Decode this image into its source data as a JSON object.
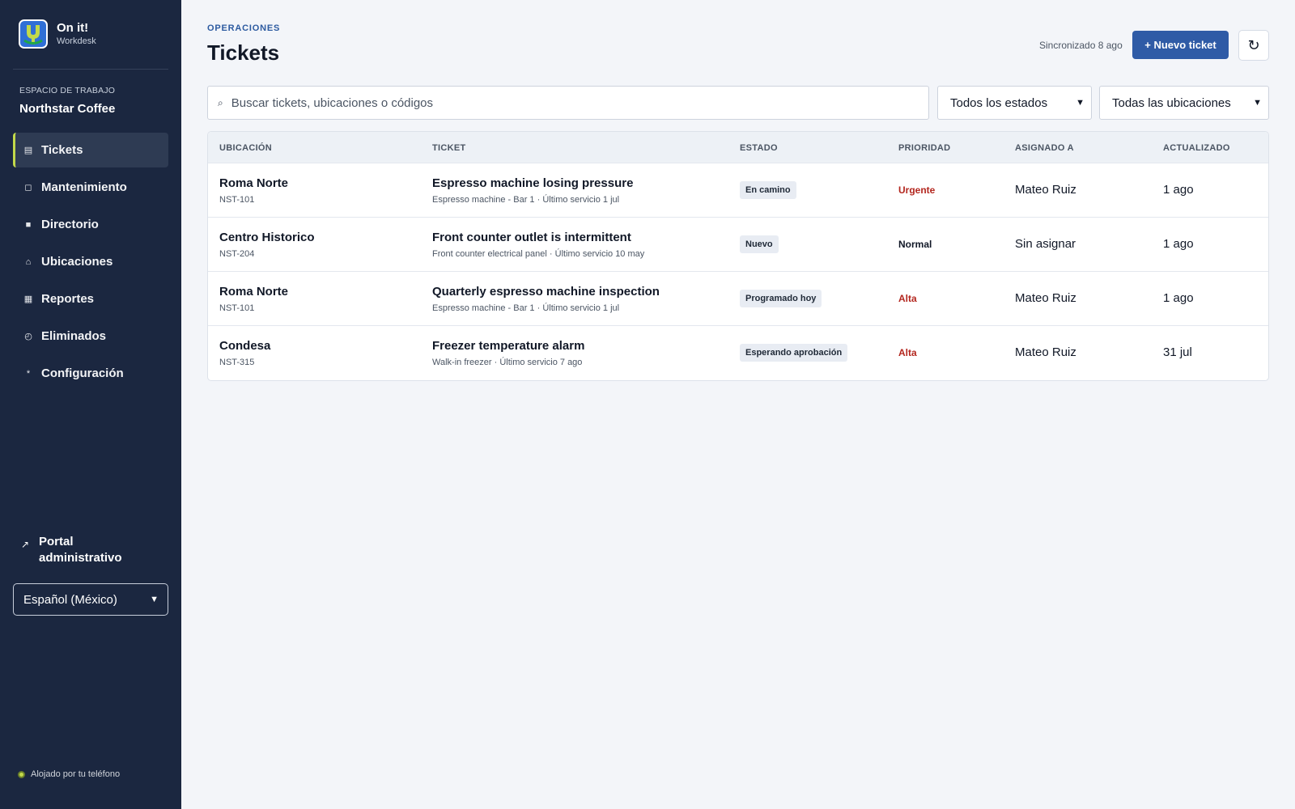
{
  "brand": {
    "name": "On it!",
    "subtitle": "Workdesk"
  },
  "workspace": {
    "label": "ESPACIO DE TRABAJO",
    "name": "Northstar Coffee"
  },
  "sidebar": {
    "items": [
      {
        "label": "Tickets",
        "icon": "ticket-list-icon",
        "glyph": "▤"
      },
      {
        "label": "Mantenimiento",
        "icon": "maintenance-icon",
        "glyph": "◻"
      },
      {
        "label": "Directorio",
        "icon": "person-icon",
        "glyph": "👤"
      },
      {
        "label": "Ubicaciones",
        "icon": "home-icon",
        "glyph": "⌂"
      },
      {
        "label": "Reportes",
        "icon": "reports-icon",
        "glyph": "▦"
      },
      {
        "label": "Eliminados",
        "icon": "clock-icon",
        "glyph": "◴"
      },
      {
        "label": "Configuración",
        "icon": "settings-icon",
        "glyph": "*"
      }
    ],
    "active_index": 0,
    "portal_label": "Portal administrativo",
    "portal_icon": "↗",
    "language": "Español (México)",
    "hosted": "Alojado por tu teléfono"
  },
  "header": {
    "eyebrow": "OPERACIONES",
    "title": "Tickets",
    "synced": "Sincronizado 8 ago",
    "new_ticket": "+ Nuevo ticket",
    "refresh_glyph": "↻"
  },
  "filters": {
    "search_placeholder": "Buscar tickets, ubicaciones o códigos",
    "search_glyph": "⌕",
    "status": "Todos los estados",
    "location": "Todas las ubicaciones",
    "chevron": "⌄"
  },
  "table": {
    "columns": [
      "UBICACIÓN",
      "TICKET",
      "ESTADO",
      "PRIORIDAD",
      "ASIGNADO A",
      "ACTUALIZADO"
    ],
    "rows": [
      {
        "location": "Roma Norte",
        "code": "NST-101",
        "title": "Espresso machine losing pressure",
        "sub": "Espresso machine - Bar 1 · Último servicio 1 jul",
        "status": "En camino",
        "priority": "Urgente",
        "priority_color": "#b3261e",
        "assignee": "Mateo Ruiz",
        "updated": "1 ago"
      },
      {
        "location": "Centro Historico",
        "code": "NST-204",
        "title": "Front counter outlet is intermittent",
        "sub": "Front counter electrical panel · Último servicio 10 may",
        "status": "Nuevo",
        "priority": "Normal",
        "priority_color": "#111827",
        "assignee": "Sin asignar",
        "updated": "1 ago"
      },
      {
        "location": "Roma Norte",
        "code": "NST-101",
        "title": "Quarterly espresso machine inspection",
        "sub": "Espresso machine - Bar 1 · Último servicio 1 jul",
        "status": "Programado hoy",
        "priority": "Alta",
        "priority_color": "#b3261e",
        "assignee": "Mateo Ruiz",
        "updated": "1 ago"
      },
      {
        "location": "Condesa",
        "code": "NST-315",
        "title": "Freezer temperature alarm",
        "sub": "Walk-in freezer · Último servicio 7 ago",
        "status": "Esperando aprobación",
        "priority": "Alta",
        "priority_color": "#b3261e",
        "assignee": "Mateo Ruiz",
        "updated": "31 jul"
      }
    ]
  },
  "colors": {
    "sidebar_bg": "#1b2740",
    "accent": "#2f5ba6",
    "active_marker": "#c2d94a",
    "danger": "#b3261e"
  }
}
